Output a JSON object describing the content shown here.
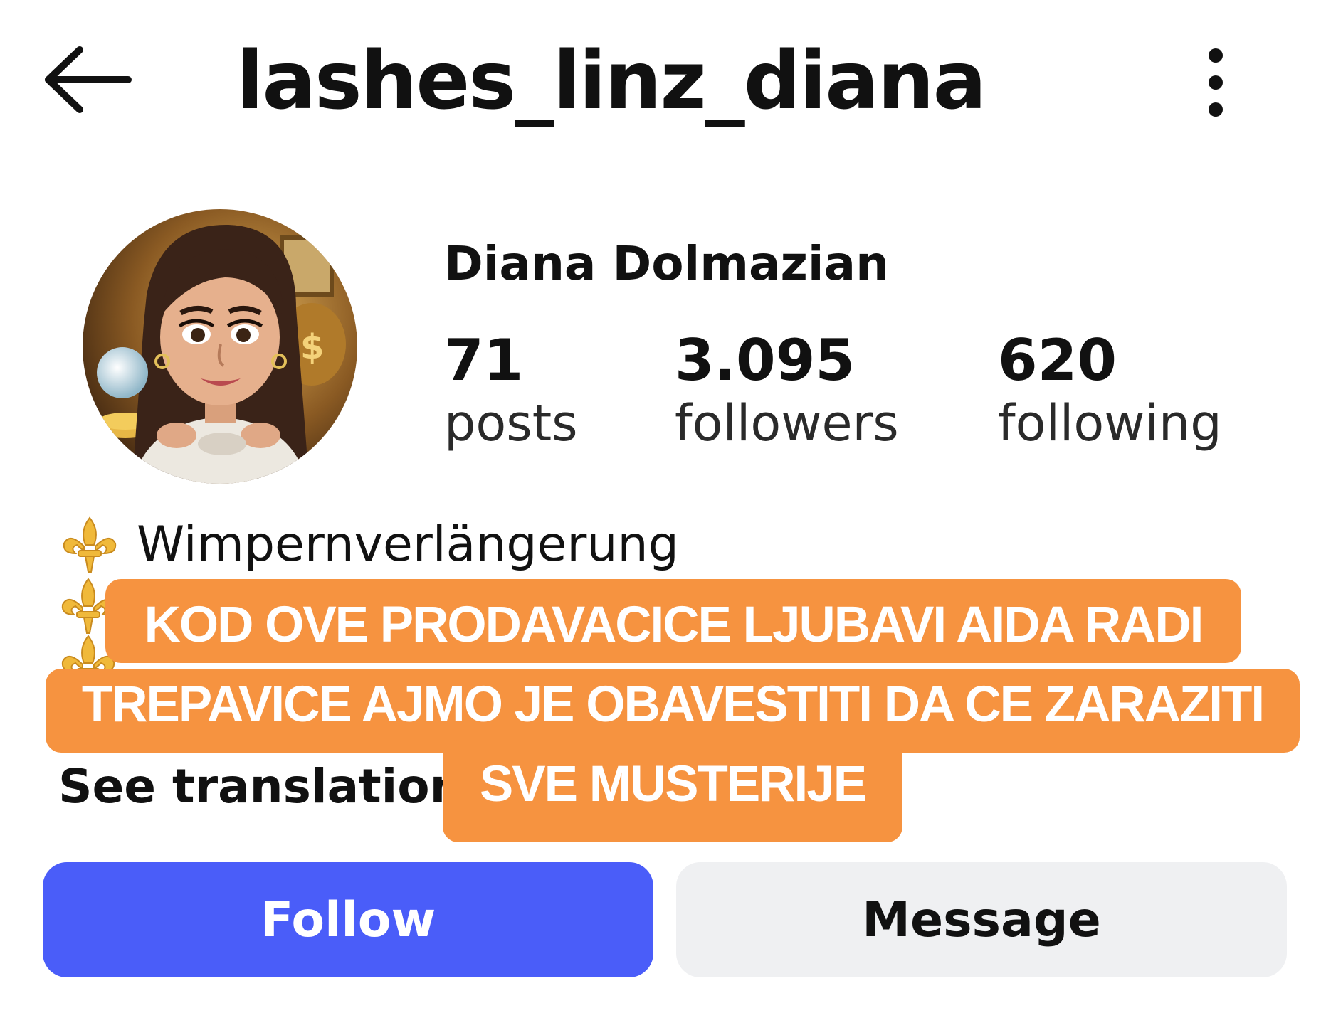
{
  "header": {
    "username": "lashes_linz_diana",
    "back_icon": "arrow-left-icon",
    "more_icon": "more-vertical-icon"
  },
  "profile": {
    "display_name": "Diana Dolmazian",
    "avatar_icon": "profile-avatar-illustration",
    "stats": [
      {
        "count": "71",
        "label": "posts"
      },
      {
        "count": "3.095",
        "label": "followers"
      },
      {
        "count": "620",
        "label": "following"
      }
    ]
  },
  "bio": {
    "bullet_icon": "fleur-de-lis-icon",
    "line1": "Wimpernverlängerung",
    "see_translation": "See translation"
  },
  "caption_overlay": {
    "lines": [
      "KOD OVE PRODAVACICE LJUBAVI AIDA RADI",
      "TREPAVICE AJMO JE OBAVESTITI DA CE ZARAZITI",
      "SVE MUSTERIJE"
    ],
    "background_color": "#f69340"
  },
  "actions": {
    "follow_label": "Follow",
    "message_label": "Message",
    "follow_color": "#4a5df9",
    "message_color": "#eff0f2"
  }
}
